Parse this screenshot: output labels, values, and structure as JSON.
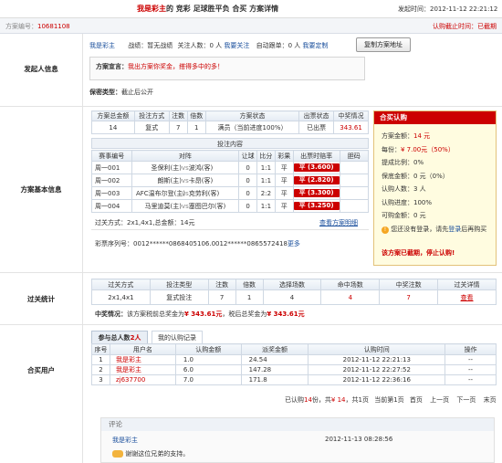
{
  "header": {
    "title_user": "我是彩主",
    "title_rest": "的 竞彩 足球胜平负 合买 方案详情",
    "start_label": "发起时间：",
    "start_time": "2012-11-12 22:21:12",
    "scheme_no_label": "方案编号：",
    "scheme_no": "10681108",
    "deadline_label": "认购截止时间：",
    "deadline_status": "已截期"
  },
  "initiator": {
    "section_label": "发起人信息",
    "username": "我是彩主",
    "record_label": "战绩：",
    "record_value": "暂无战绩",
    "followers_label": "关注人数：",
    "followers_value": "0 人",
    "follow_link": "我要关注",
    "auto_follow_label": "自动跟单：",
    "auto_follow_value": "0 人",
    "customize_link": "我要定制",
    "copy_button": "复制方案地址",
    "declaration_label": "方案宣言：",
    "declaration_text": "我出方案你奖金，搭得多中的多！",
    "secrecy_label": "保密类型：",
    "secrecy_value": "截止后公开"
  },
  "scheme": {
    "section_label": "方案基本信息",
    "summary_headers": [
      "方案总金额",
      "投注方式",
      "注数",
      "倍数",
      "方案状态",
      "出票状态",
      "中奖情况"
    ],
    "summary_row": [
      "14",
      "复式",
      "7",
      "1",
      "满员（当前进度100%）",
      "已出票",
      "343.61"
    ],
    "bet_title": "投注内容",
    "bet_headers": [
      "赛事编号",
      "对阵",
      "让球",
      "比分",
      "彩果",
      "出票时赔率",
      "胆码"
    ],
    "bets": [
      {
        "no": "周一001",
        "home": "圣保利(主)",
        "away": "波鸿(客)",
        "handicap": "0",
        "score": "1:1",
        "result": "平",
        "odds": "平 (3.600)",
        "banker": ""
      },
      {
        "no": "周一002",
        "home": "朗斯(主)",
        "away": "卡昂(客)",
        "handicap": "0",
        "score": "1:1",
        "result": "平",
        "odds": "平 (2.820)",
        "banker": ""
      },
      {
        "no": "周一003",
        "home": "AFC温布尔登(主)",
        "away": "克劳利(客)",
        "handicap": "0",
        "score": "2:2",
        "result": "平",
        "odds": "平 (3.300)",
        "banker": ""
      },
      {
        "no": "周一004",
        "home": "马里迪莫(主)",
        "away": "塞图巴尔(客)",
        "handicap": "0",
        "score": "1:1",
        "result": "平",
        "odds": "平 (3.250)",
        "banker": ""
      }
    ],
    "pass_info": "过关方式：2x1,4x1,总金额：14元",
    "view_detail_link": "查看方案明细",
    "serial_label": "彩票序列号：",
    "serial_value": "0012******0868405106.0012******0865572418",
    "more_link": "更多",
    "vs": "vs"
  },
  "join_panel": {
    "title": "合买认购",
    "total_label": "方案金额：",
    "total_value": "14 元",
    "unit_label": "每份：",
    "unit_value": "¥ 7.00元（50%）",
    "commission_label": "提成比例：",
    "commission_value": "0%",
    "guarantee_label": "保底金额：",
    "guarantee_value": "0 元（0%）",
    "joiners_label": "认购人数：",
    "joiners_value": "3 人",
    "progress_label": "认购进度：",
    "progress_value": "100%",
    "remain_label": "可购金额：",
    "remain_value": "0 元",
    "login_hint_pre": "您还没有登录，请先",
    "login_link": "登录",
    "login_hint_post": "后再购买",
    "closed_notice": "该方案已截期，停止认购!"
  },
  "pass_stats": {
    "section_label": "过关统计",
    "headers": [
      "过关方式",
      "投注类型",
      "注数",
      "倍数",
      "选择场数",
      "命中场数",
      "中奖注数",
      "过关详情"
    ],
    "row": [
      "2x1,4x1",
      "复式投注",
      "7",
      "1",
      "4",
      "4",
      "7",
      "查看"
    ],
    "prize_label": "中奖情况：",
    "prize_text_pre": "该方案税前总奖金为",
    "prize_pre_tax": "¥ 343.61元",
    "prize_text_mid": "，税后总奖金为",
    "prize_after_tax": "¥ 343.61元"
  },
  "members": {
    "section_label": "合买用户",
    "tab_all_prefix": "参与总人数",
    "tab_all_count": "2人",
    "tab_mine": "我的认购记录",
    "headers": [
      "序号",
      "用户名",
      "认购金额",
      "派奖金额",
      "认购时间",
      "操作"
    ],
    "rows": [
      {
        "no": "1",
        "user": "我是彩主",
        "amount": "1.0",
        "prize": "24.54",
        "time": "2012-11-12 22:21:13",
        "op": "--"
      },
      {
        "no": "2",
        "user": "我是彩主",
        "amount": "6.0",
        "prize": "147.28",
        "time": "2012-11-12 22:27:52",
        "op": "--"
      },
      {
        "no": "3",
        "user": "zj637700",
        "amount": "7.0",
        "prize": "171.8",
        "time": "2012-11-12 22:36:16",
        "op": "--"
      }
    ],
    "pager": {
      "summary_pre": "已认购",
      "summary_count": "14",
      "summary_mid": "份，共",
      "summary_amount": "¥ 14",
      "summary_post": "，共1页",
      "current": "当前第1页",
      "first": "首页",
      "prev": "上一页",
      "next": "下一页",
      "last": "末页"
    }
  },
  "comments": {
    "title": "评论",
    "user": "我是彩主",
    "time": "2012-11-13 08:28:56",
    "text": "谢谢这位兄弟的支持。"
  },
  "colors": {
    "accent_red": "#cc0000",
    "link_blue": "#1a4f9c",
    "panel_bg": "#fffce0"
  }
}
